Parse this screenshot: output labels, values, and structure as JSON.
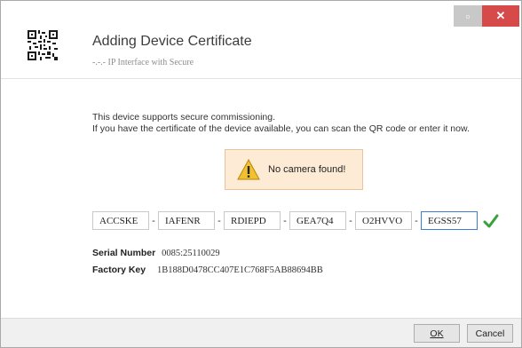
{
  "window": {
    "minimize_glyph": "▫",
    "close_glyph": "✕"
  },
  "header": {
    "title": "Adding Device Certificate",
    "subtitle": "-.-.- IP Interface with Secure",
    "icon": "qr-code-icon"
  },
  "description": {
    "line1": "This device supports secure commissioning.",
    "line2": "If you have the certificate of the device available, you can scan the QR code or enter it now."
  },
  "alert": {
    "text": "No camera found!",
    "icon": "warning-icon",
    "bg_color": "#fdebd6"
  },
  "key_fields": [
    "ACCSKE",
    "IAFENR",
    "RDIEPD",
    "GEA7Q4",
    "O2HVVO",
    "EGSS57"
  ],
  "key_separator": "-",
  "validation_icon": "check-icon",
  "info": {
    "serial_label": "Serial Number",
    "serial_value": "0085:25110029",
    "factory_label": "Factory Key",
    "factory_value": "1B188D0478CC407E1C768F5AB88694BB"
  },
  "footer": {
    "ok_label": "OK",
    "cancel_label": "Cancel"
  },
  "colors": {
    "close_button": "#d64a4a",
    "check": "#3aa13a",
    "focus_border": "#3d7bd6"
  }
}
